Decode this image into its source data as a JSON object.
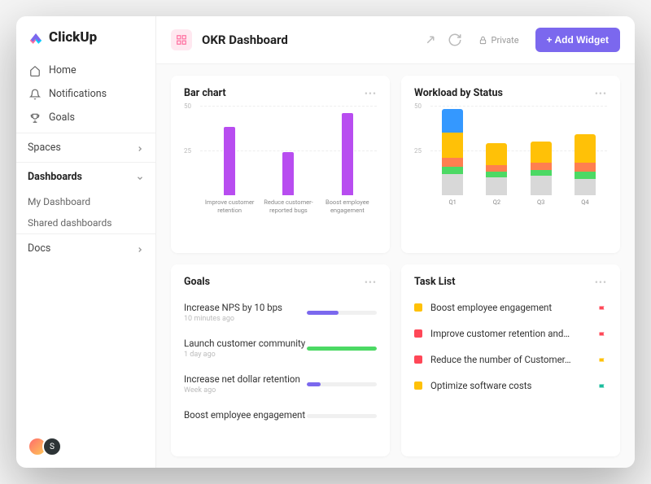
{
  "brand": {
    "name": "ClickUp"
  },
  "sidebar": {
    "nav": [
      {
        "label": "Home",
        "icon": "home"
      },
      {
        "label": "Notifications",
        "icon": "bell"
      },
      {
        "label": "Goals",
        "icon": "trophy"
      }
    ],
    "sections": {
      "spaces": {
        "label": "Spaces"
      },
      "dashboards": {
        "label": "Dashboards",
        "items": [
          {
            "label": "My Dashboard"
          },
          {
            "label": "Shared dashboards"
          }
        ]
      },
      "docs": {
        "label": "Docs"
      }
    },
    "avatar_initial": "S"
  },
  "header": {
    "title": "OKR Dashboard",
    "private_label": "Private",
    "add_widget_label": "+ Add Widget"
  },
  "cards": {
    "bar": {
      "title": "Bar chart"
    },
    "workload": {
      "title": "Workload by Status"
    },
    "goals": {
      "title": "Goals",
      "items": [
        {
          "name": "Increase NPS by 10 bps",
          "time": "10 minutes ago",
          "progress": 45,
          "color": "#7b68ee"
        },
        {
          "name": "Launch customer community",
          "time": "1 day ago",
          "progress": 100,
          "color": "#4cd964"
        },
        {
          "name": "Increase net dollar retention",
          "time": "Week ago",
          "progress": 20,
          "color": "#7b68ee"
        },
        {
          "name": "Boost employee engagement",
          "time": "",
          "progress": 0,
          "color": "#7b68ee"
        }
      ]
    },
    "tasks": {
      "title": "Task List",
      "items": [
        {
          "name": "Boost employee engagement",
          "color": "#ffc107",
          "flag": "#ff4757"
        },
        {
          "name": "Improve customer retention and…",
          "color": "#ff4757",
          "flag": "#ff4757"
        },
        {
          "name": "Reduce the number of Customer…",
          "color": "#ff4757",
          "flag": "#ffc107"
        },
        {
          "name": "Optimize software costs",
          "color": "#ffc107",
          "flag": "#1abc9c"
        }
      ]
    }
  },
  "chart_data": [
    {
      "type": "bar",
      "title": "Bar chart",
      "categories": [
        "Improve customer retention",
        "Reduce customer-reported bugs",
        "Boost employee engagement"
      ],
      "values": [
        38,
        24,
        46
      ],
      "ylim": [
        0,
        50
      ],
      "yticks": [
        25,
        50
      ],
      "color": "#b84df0"
    },
    {
      "type": "stacked-bar",
      "title": "Workload by Status",
      "categories": [
        "Q1",
        "Q2",
        "Q3",
        "Q4"
      ],
      "ylim": [
        0,
        50
      ],
      "yticks": [
        25,
        50
      ],
      "series": [
        {
          "name": "gray",
          "color": "#d8d8d8",
          "values": [
            12,
            10,
            11,
            9
          ]
        },
        {
          "name": "green",
          "color": "#4cd964",
          "values": [
            4,
            3,
            3,
            4
          ]
        },
        {
          "name": "orange",
          "color": "#ff7f50",
          "values": [
            5,
            4,
            4,
            5
          ]
        },
        {
          "name": "yellow",
          "color": "#ffc107",
          "values": [
            14,
            12,
            12,
            16
          ]
        },
        {
          "name": "blue",
          "color": "#3498ff",
          "values": [
            13,
            0,
            0,
            0
          ]
        }
      ]
    }
  ]
}
